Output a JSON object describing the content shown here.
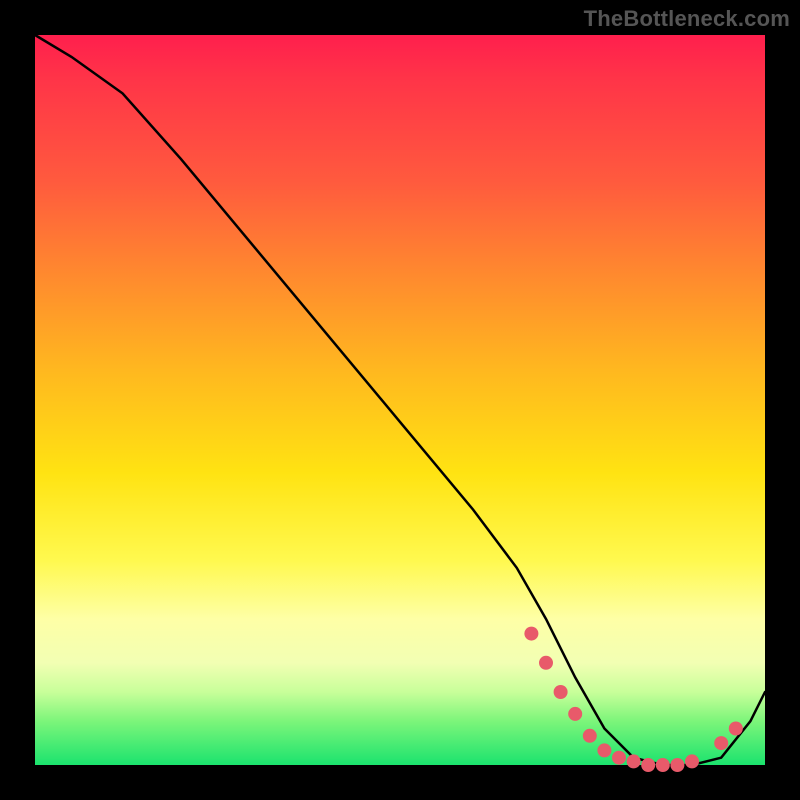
{
  "watermark": "TheBottleneck.com",
  "chart_data": {
    "type": "line",
    "title": "",
    "xlabel": "",
    "ylabel": "",
    "xlim": [
      0,
      100
    ],
    "ylim": [
      0,
      100
    ],
    "series": [
      {
        "name": "curve",
        "x": [
          0,
          5,
          12,
          20,
          30,
          40,
          50,
          60,
          66,
          70,
          74,
          78,
          82,
          86,
          90,
          94,
          98,
          100
        ],
        "y": [
          100,
          97,
          92,
          83,
          71,
          59,
          47,
          35,
          27,
          20,
          12,
          5,
          1,
          0,
          0,
          1,
          6,
          10
        ]
      }
    ],
    "markers": [
      {
        "x": 68,
        "y": 18
      },
      {
        "x": 70,
        "y": 14
      },
      {
        "x": 72,
        "y": 10
      },
      {
        "x": 74,
        "y": 7
      },
      {
        "x": 76,
        "y": 4
      },
      {
        "x": 78,
        "y": 2
      },
      {
        "x": 80,
        "y": 1
      },
      {
        "x": 82,
        "y": 0.5
      },
      {
        "x": 84,
        "y": 0
      },
      {
        "x": 86,
        "y": 0
      },
      {
        "x": 88,
        "y": 0
      },
      {
        "x": 90,
        "y": 0.5
      },
      {
        "x": 94,
        "y": 3
      },
      {
        "x": 96,
        "y": 5
      }
    ],
    "colors": {
      "curve": "#000000",
      "markers": "#e85a6a",
      "gradient_top": "#ff1f4d",
      "gradient_mid": "#ffe312",
      "gradient_bottom": "#1be36e"
    }
  }
}
